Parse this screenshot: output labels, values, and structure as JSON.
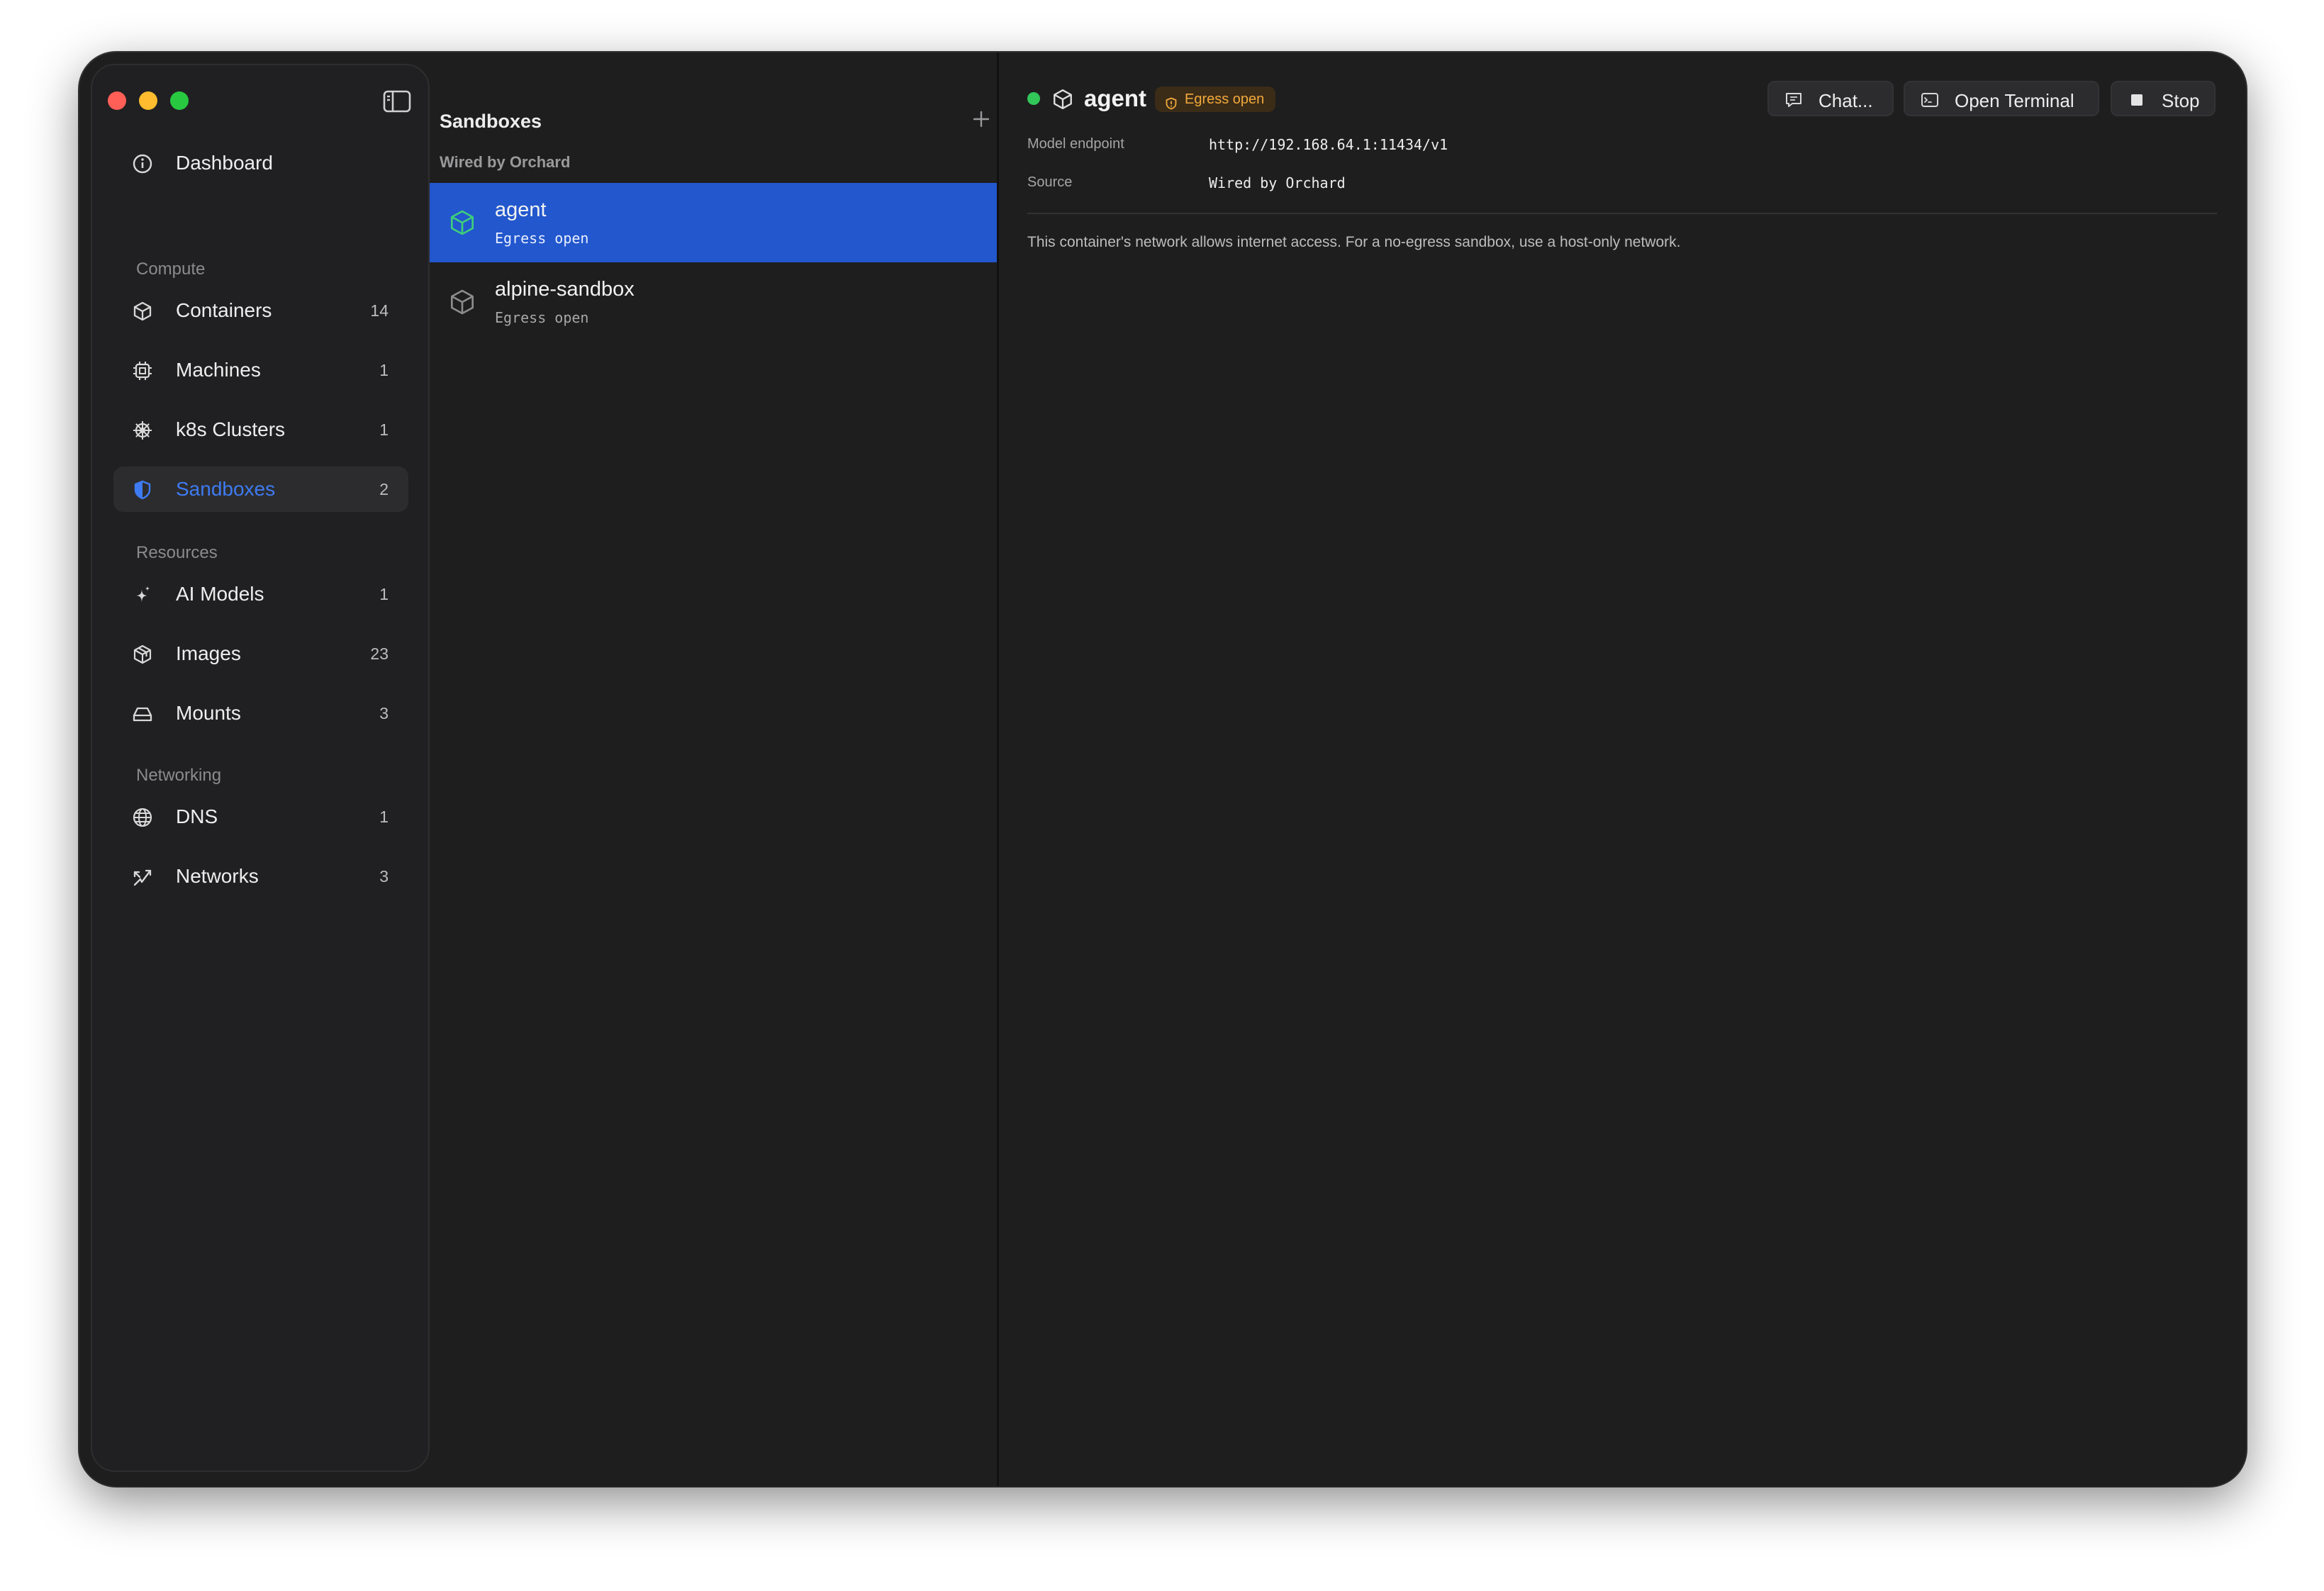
{
  "colors": {
    "accent": "#3e7bf2",
    "selected_row": "#2257cd",
    "status_running": "#31c759",
    "warning": "#f2a93a",
    "traffic_close": "#ff5f57",
    "traffic_minimize": "#febc2e",
    "traffic_zoom": "#28c840"
  },
  "sidebar": {
    "toggle_icon": "sidebar-toggle-icon",
    "top": {
      "label": "Dashboard",
      "icon": "info-circle-icon"
    },
    "sections": [
      {
        "label": "Compute",
        "items": [
          {
            "label": "Containers",
            "count": "14",
            "icon": "cube-icon"
          },
          {
            "label": "Machines",
            "count": "1",
            "icon": "chip-icon"
          },
          {
            "label": "k8s Clusters",
            "count": "1",
            "icon": "helm-wheel-icon"
          },
          {
            "label": "Sandboxes",
            "count": "2",
            "icon": "shield-icon",
            "active": true
          }
        ]
      },
      {
        "label": "Resources",
        "items": [
          {
            "label": "AI Models",
            "count": "1",
            "icon": "sparkles-icon"
          },
          {
            "label": "Images",
            "count": "23",
            "icon": "layers-cube-icon"
          },
          {
            "label": "Mounts",
            "count": "3",
            "icon": "drive-icon"
          }
        ]
      },
      {
        "label": "Networking",
        "items": [
          {
            "label": "DNS",
            "count": "1",
            "icon": "globe-icon"
          },
          {
            "label": "Networks",
            "count": "3",
            "icon": "network-arrows-icon"
          }
        ]
      }
    ]
  },
  "list": {
    "title": "Sandboxes",
    "add_icon": "plus-icon",
    "group": "Wired by Orchard",
    "items": [
      {
        "name": "agent",
        "sub": "Egress open",
        "selected": true
      },
      {
        "name": "alpine-sandbox",
        "sub": "Egress open",
        "selected": false
      }
    ]
  },
  "detail": {
    "title": "agent",
    "badge": "Egress open",
    "buttons": {
      "chat": "Chat...",
      "terminal": "Open Terminal",
      "stop": "Stop"
    },
    "fields": [
      {
        "key": "Model endpoint",
        "value": "http://192.168.64.1:11434/v1"
      },
      {
        "key": "Source",
        "value": "Wired by Orchard"
      }
    ],
    "note": "This container's network allows internet access. For a no-egress sandbox, use a host-only network."
  }
}
